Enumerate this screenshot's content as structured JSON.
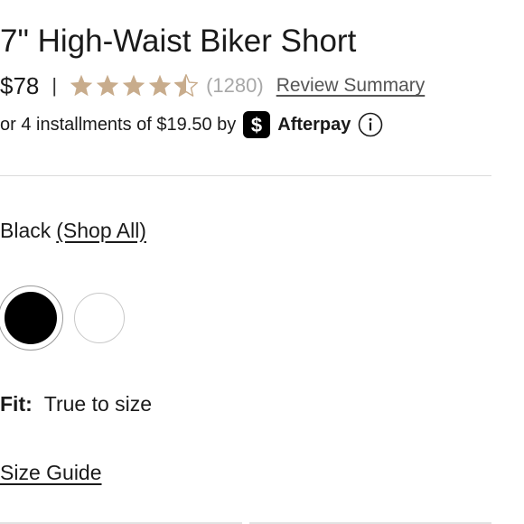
{
  "product": {
    "title": "7\" High-Waist Biker Short",
    "price": "$78",
    "separator": "|",
    "rating": {
      "value": 4.5,
      "max": 5,
      "count_text": "(1280)",
      "star_color": "#c8ac8c",
      "review_link": "Review Summary"
    }
  },
  "afterpay": {
    "text": "or 4 installments of $19.50 by",
    "badge_icon": "afterpay-dollar-icon",
    "brand": "Afterpay",
    "info_icon": "info-icon"
  },
  "color": {
    "selected": "Black",
    "shop_all": "(Shop All)",
    "swatches": [
      {
        "name": "Black",
        "hex": "#000000",
        "selected": true
      },
      {
        "name": "White",
        "hex": "#ffffff",
        "selected": false
      }
    ]
  },
  "fit": {
    "label": "Fit:",
    "value": "True to size"
  },
  "size_guide": "Size Guide"
}
